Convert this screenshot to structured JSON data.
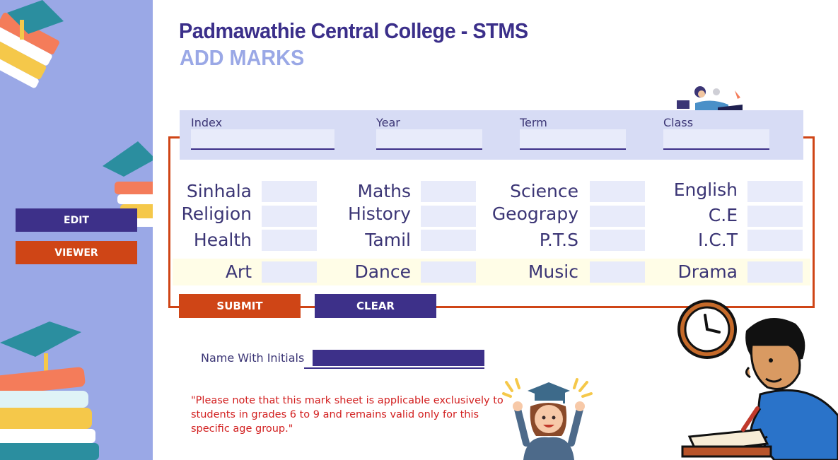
{
  "sidebar": {
    "edit_label": "EDIT",
    "viewer_label": "VIEWER"
  },
  "header": {
    "title": "Padmawathie Central College - STMS",
    "subtitle": "ADD MARKS"
  },
  "top_fields": {
    "index": {
      "label": "Index",
      "value": ""
    },
    "year": {
      "label": "Year",
      "value": ""
    },
    "term": {
      "label": "Term",
      "value": ""
    },
    "class": {
      "label": "Class",
      "value": ""
    }
  },
  "subjects": {
    "sinhala": "Sinhala",
    "maths": "Maths",
    "science": "Science",
    "english": "English",
    "religion": "Religion",
    "history": "History",
    "geography": "Geograpy",
    "ce": "C.E",
    "health": "Health",
    "tamil": "Tamil",
    "pts": "P.T.S",
    "ict": "I.C.T",
    "art": "Art",
    "dance": "Dance",
    "music": "Music",
    "drama": "Drama"
  },
  "actions": {
    "submit_label": "SUBMIT",
    "clear_label": "CLEAR"
  },
  "name_field": {
    "label": "Name With Initials",
    "value": ""
  },
  "note": "\"Please note that this mark sheet is applicable exclusively to students in grades 6 to 9 and remains valid only for this specific age group.\"",
  "colors": {
    "sidebar_bg": "#9aa8e6",
    "primary": "#3d3089",
    "accent": "#cf4516",
    "note_text": "#d21f1f"
  },
  "icons": [
    "books-graduation-cap-icon",
    "girl-with-laptop-icon",
    "graduate-student-icon",
    "boy-writing-clock-icon"
  ]
}
